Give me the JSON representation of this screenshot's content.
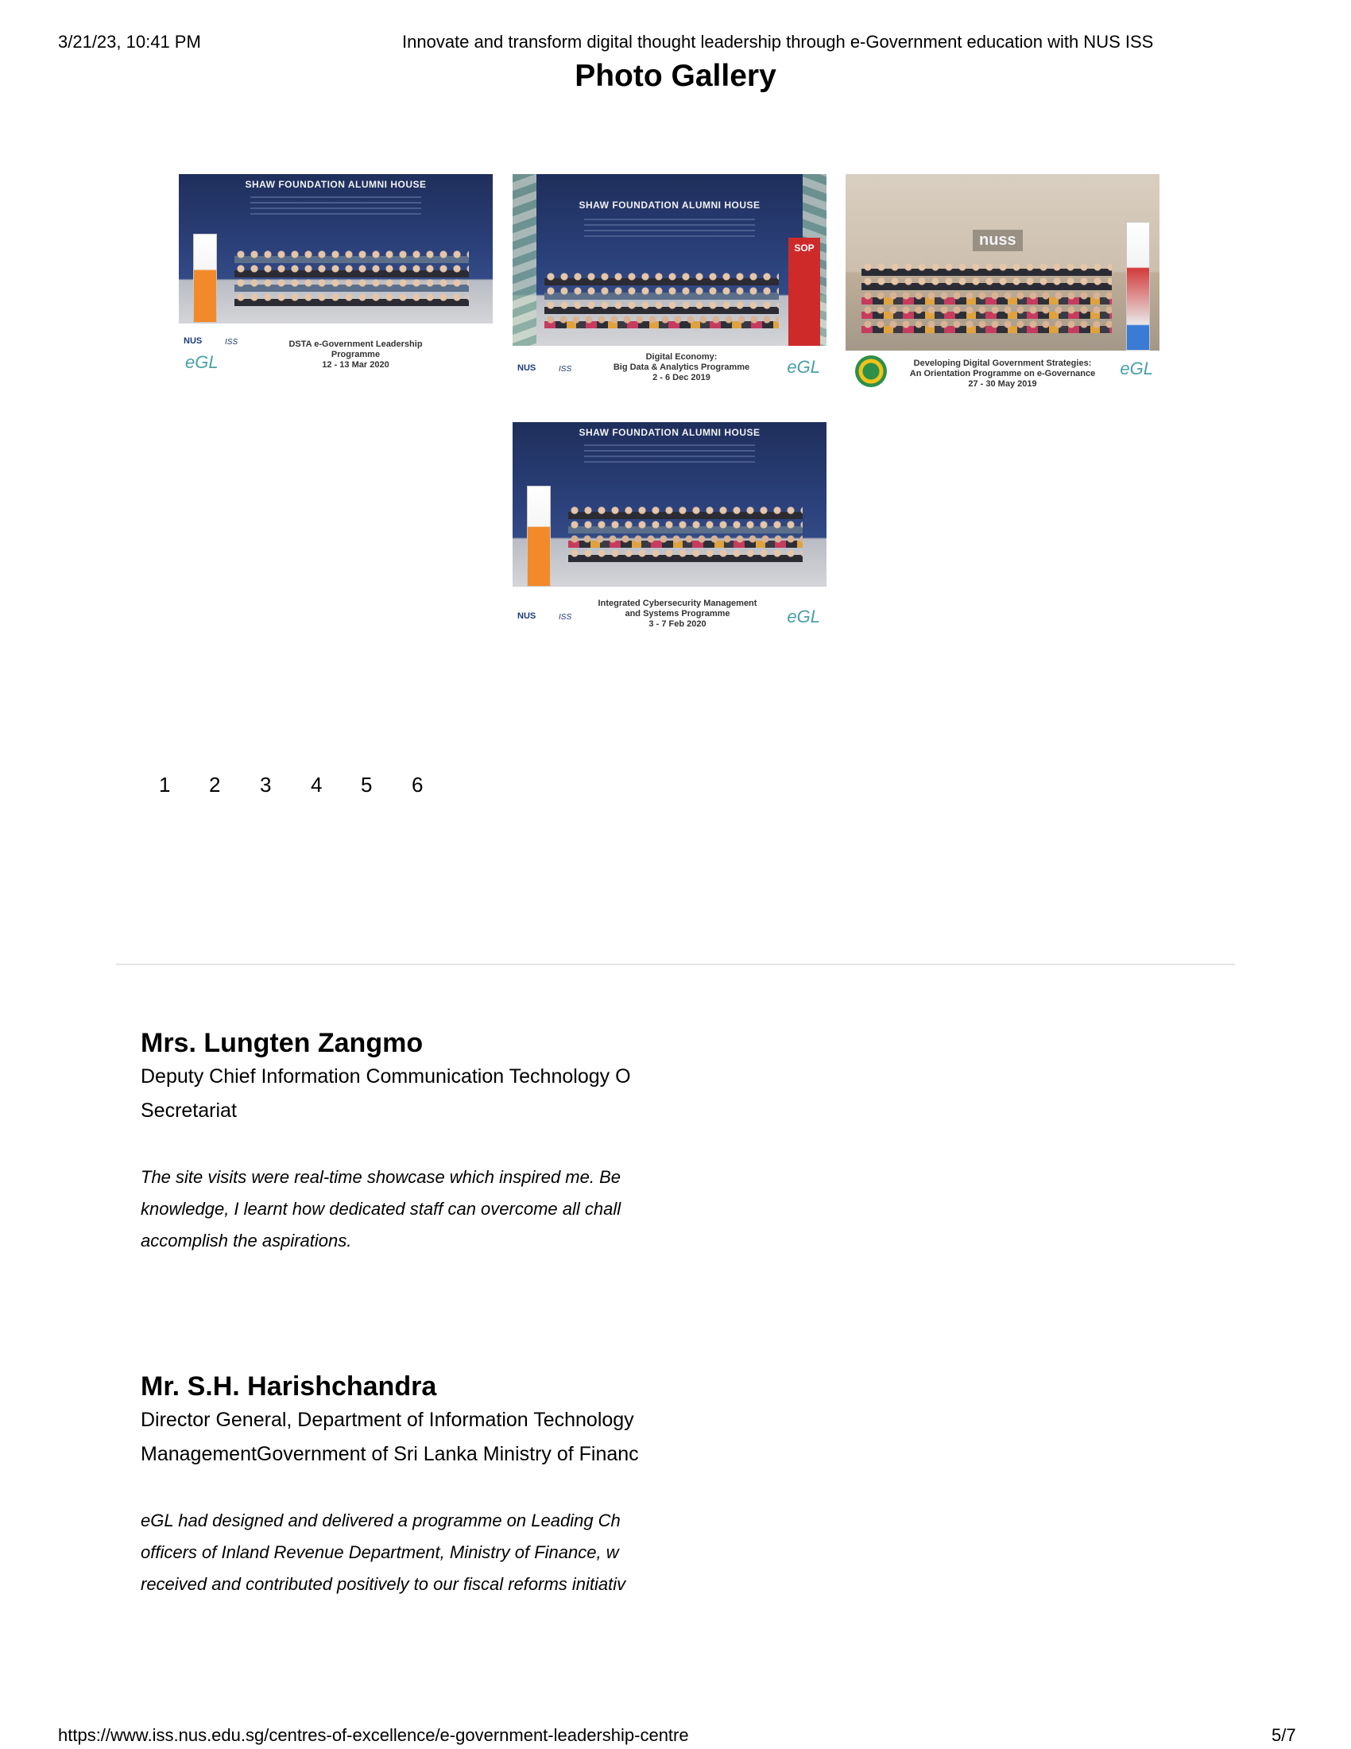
{
  "header": {
    "datetime": "3/21/23, 10:41 PM",
    "page_title": "Innovate and transform digital thought leadership through e-Government education with NUS ISS"
  },
  "gallery": {
    "title": "Photo Gallery",
    "photos": [
      {
        "sign": "SHAW FOUNDATION ALUMNI HOUSE",
        "caption": [
          "DSTA e-Government Leadership",
          "Programme",
          "12 - 13 Mar 2020"
        ],
        "logos": [
          "NUS",
          "ISS",
          "eGL"
        ]
      },
      {
        "sign": "SHAW FOUNDATION ALUMNI HOUSE",
        "caption": [
          "Digital Economy:",
          "Big Data & Analytics Programme",
          "2 - 6 Dec 2019"
        ],
        "logos": [
          "NUS",
          "ISS",
          "eGL",
          "SOP"
        ]
      },
      {
        "sign": "nuss",
        "caption": [
          "Developing Digital Government Strategies:",
          "An Orientation Programme on e-Governance",
          "27 - 30 May 2019"
        ],
        "logos": [
          "eGL"
        ]
      },
      {
        "sign": "SHAW FOUNDATION ALUMNI HOUSE",
        "caption": [
          "Integrated Cybersecurity Management",
          "and Systems Programme",
          "3 - 7 Feb 2020"
        ],
        "logos": [
          "NUS",
          "ISS",
          "eGL"
        ]
      }
    ],
    "pages": [
      "1",
      "2",
      "3",
      "4",
      "5",
      "6"
    ]
  },
  "testimonials": [
    {
      "name": "Mrs. Lungten Zangmo",
      "title_lines": [
        "Deputy Chief Information Communication Technology O",
        "Secretariat"
      ],
      "quote_lines": [
        "The site visits were real-time showcase which inspired me. Be",
        "knowledge, I learnt how dedicated staff can overcome all chall",
        "accomplish the aspirations."
      ]
    },
    {
      "name": "Mr. S.H. Harishchandra",
      "title_lines": [
        "Director General, Department of Information Technology",
        "ManagementGovernment of Sri Lanka Ministry of Financ"
      ],
      "quote_lines": [
        "eGL had designed and delivered a programme on Leading Ch",
        "officers of Inland Revenue Department, Ministry of Finance, w",
        "received and contributed positively to our fiscal reforms initiativ"
      ]
    }
  ],
  "footer": {
    "url": "https://www.iss.nus.edu.sg/centres-of-excellence/e-government-leadership-centre",
    "page_number": "5/7"
  }
}
